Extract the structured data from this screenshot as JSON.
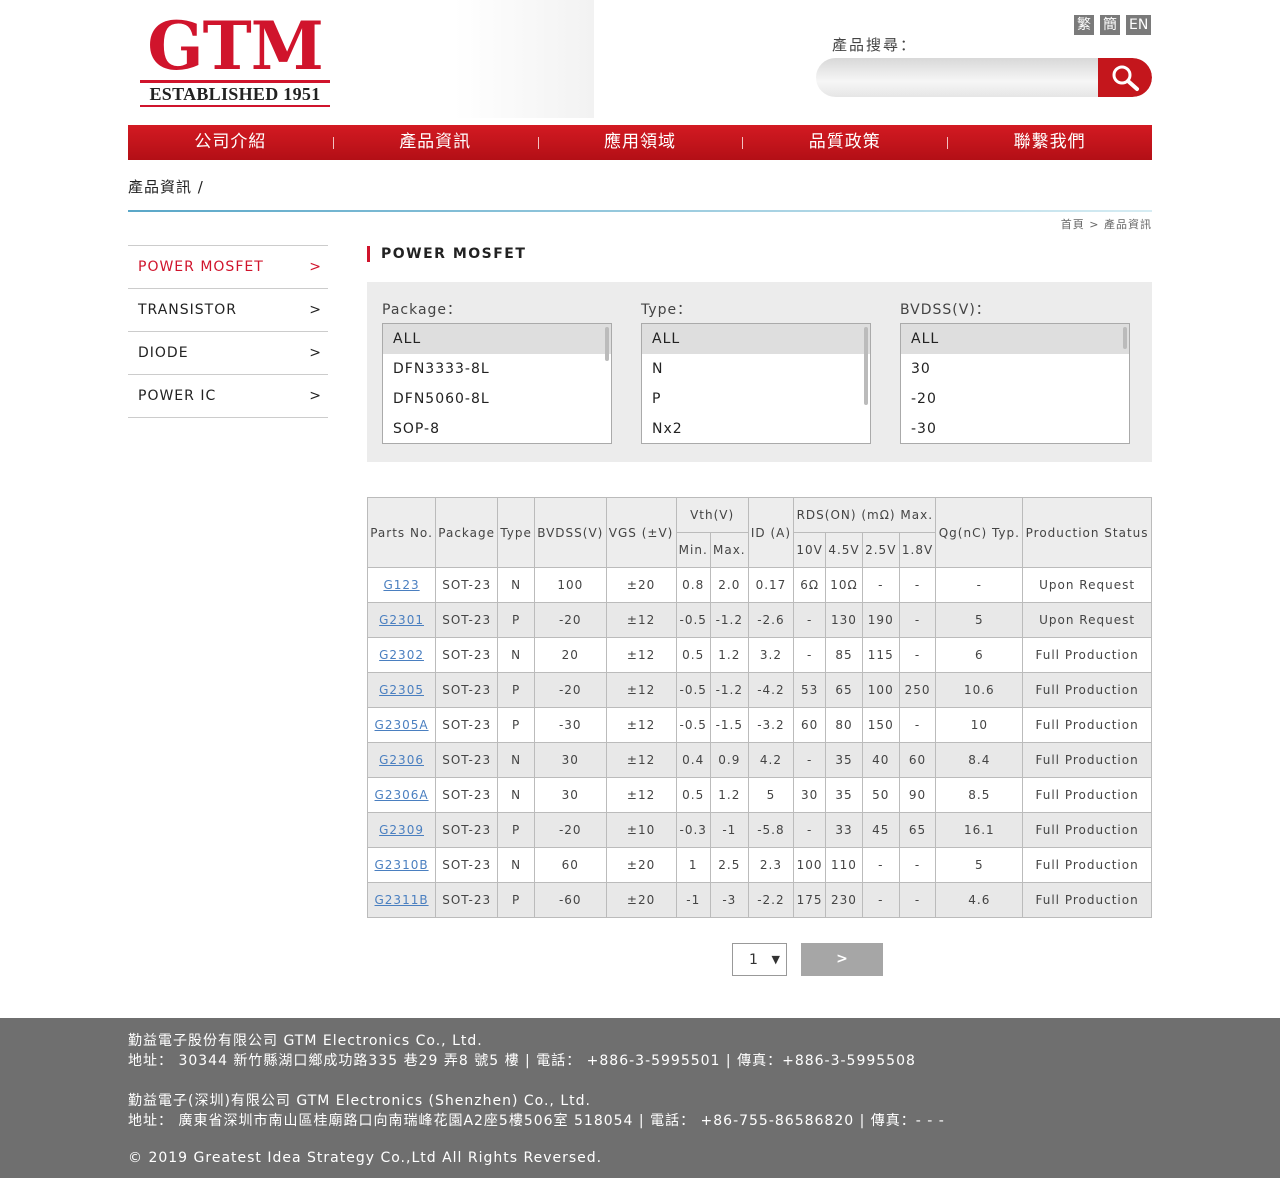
{
  "logo": {
    "name": "GTM",
    "established": "ESTABLISHED 1951"
  },
  "lang": [
    "繁",
    "簡",
    "EN"
  ],
  "search": {
    "label": "產品搜尋：",
    "placeholder": ""
  },
  "nav": [
    "公司介紹",
    "產品資訊",
    "應用領域",
    "品質政策",
    "聯繫我們"
  ],
  "page_title": "產品資訊 /",
  "breadcrumb": {
    "home": "首頁",
    "sep": ">",
    "current": "產品資訊"
  },
  "sidebar": [
    {
      "label": "POWER MOSFET",
      "arrow": ">",
      "active": true
    },
    {
      "label": "TRANSISTOR",
      "arrow": ">"
    },
    {
      "label": "DIODE",
      "arrow": ">"
    },
    {
      "label": "POWER IC",
      "arrow": ">"
    }
  ],
  "section_title": "POWER MOSFET",
  "filters": {
    "package": {
      "label": "Package：",
      "options": [
        "ALL",
        "DFN3333-8L",
        "DFN5060-8L",
        "SOP-8"
      ]
    },
    "type": {
      "label": "Type：",
      "options": [
        "ALL",
        "N",
        "P",
        "Nx2"
      ]
    },
    "bvdss": {
      "label": "BVDSS(V)：",
      "options": [
        "ALL",
        "30",
        "-20",
        "-30"
      ]
    }
  },
  "table": {
    "headers": {
      "parts_no": "Parts No.",
      "package": "Package",
      "type": "Type",
      "bvdss": "BVDSS(V)",
      "vgs": "VGS (±V)",
      "vth": "Vth(V)",
      "vth_min": "Min.",
      "vth_max": "Max.",
      "id": "ID (A)",
      "rds": "RDS(ON) (mΩ) Max.",
      "rds_10v": "10V",
      "rds_45v": "4.5V",
      "rds_25v": "2.5V",
      "rds_18v": "1.8V",
      "qg": "Qg(nC) Typ.",
      "status": "Production Status"
    },
    "rows": [
      [
        "G123",
        "SOT-23",
        "N",
        "100",
        "±20",
        "0.8",
        "2.0",
        "0.17",
        "6Ω",
        "10Ω",
        "-",
        "-",
        "-",
        "Upon Request"
      ],
      [
        "G2301",
        "SOT-23",
        "P",
        "-20",
        "±12",
        "-0.5",
        "-1.2",
        "-2.6",
        "-",
        "130",
        "190",
        "-",
        "5",
        "Upon Request"
      ],
      [
        "G2302",
        "SOT-23",
        "N",
        "20",
        "±12",
        "0.5",
        "1.2",
        "3.2",
        "-",
        "85",
        "115",
        "-",
        "6",
        "Full Production"
      ],
      [
        "G2305",
        "SOT-23",
        "P",
        "-20",
        "±12",
        "-0.5",
        "-1.2",
        "-4.2",
        "53",
        "65",
        "100",
        "250",
        "10.6",
        "Full Production"
      ],
      [
        "G2305A",
        "SOT-23",
        "P",
        "-30",
        "±12",
        "-0.5",
        "-1.5",
        "-3.2",
        "60",
        "80",
        "150",
        "-",
        "10",
        "Full Production"
      ],
      [
        "G2306",
        "SOT-23",
        "N",
        "30",
        "±12",
        "0.4",
        "0.9",
        "4.2",
        "-",
        "35",
        "40",
        "60",
        "8.4",
        "Full Production"
      ],
      [
        "G2306A",
        "SOT-23",
        "N",
        "30",
        "±12",
        "0.5",
        "1.2",
        "5",
        "30",
        "35",
        "50",
        "90",
        "8.5",
        "Full Production"
      ],
      [
        "G2309",
        "SOT-23",
        "P",
        "-20",
        "±10",
        "-0.3",
        "-1",
        "-5.8",
        "-",
        "33",
        "45",
        "65",
        "16.1",
        "Full Production"
      ],
      [
        "G2310B",
        "SOT-23",
        "N",
        "60",
        "±20",
        "1",
        "2.5",
        "2.3",
        "100",
        "110",
        "-",
        "-",
        "5",
        "Full Production"
      ],
      [
        "G2311B",
        "SOT-23",
        "P",
        "-60",
        "±20",
        "-1",
        "-3",
        "-2.2",
        "175",
        "230",
        "-",
        "-",
        "4.6",
        "Full Production"
      ]
    ]
  },
  "pagination": {
    "page": "1",
    "caret": "▼",
    "next": ">"
  },
  "footer": {
    "company1": "勤益電子股份有限公司 GTM Electronics Co., Ltd.",
    "address1": "地址： 30344 新竹縣湖口鄉成功路335 巷29 弄8 號5 樓 | 電話： +886-3-5995501 | 傳真：+886-3-5995508",
    "company2": "勤益電子(深圳)有限公司 GTM Electronics (Shenzhen) Co., Ltd.",
    "address2": "地址： 廣東省深圳市南山區桂廟路口向南瑞峰花園A2座5樓506室 518054 | 電話： +86-755-86586820 | 傳真：- - -",
    "copyright": "© 2019 Greatest Idea Strategy Co.,Ltd All Rights Reversed."
  },
  "colors": {
    "brand_red": "#d0142c",
    "nav_red": "#c4161c",
    "footer_gray": "#6f6f6f",
    "link_blue": "#4a7fc0"
  }
}
